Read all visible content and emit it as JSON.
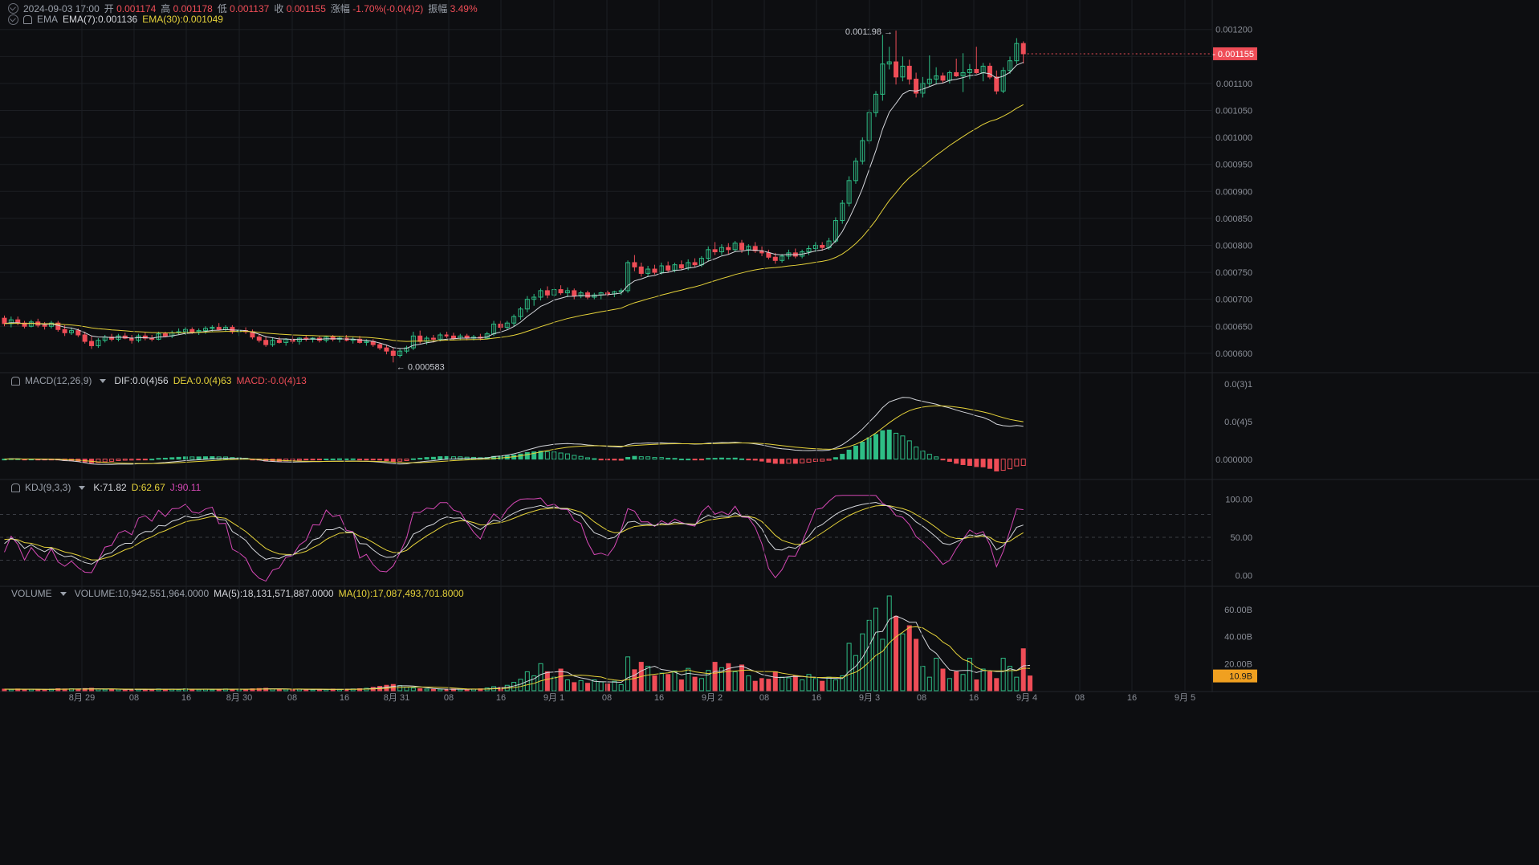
{
  "header": {
    "date": "2024-09-03 17:00",
    "open_label": "开",
    "open": "0.001174",
    "high_label": "高",
    "high": "0.001178",
    "low_label": "低",
    "low": "0.001137",
    "close_label": "收",
    "close": "0.001155",
    "change_label": "涨幅",
    "change": "-1.70%(-0.0(4)2)",
    "amp_label": "振幅",
    "amp": "3.49%"
  },
  "ema_header": {
    "name": "EMA",
    "ema7": "EMA(7):0.001136",
    "ema30": "EMA(30):0.001049"
  },
  "macd_header": {
    "name": "MACD(12,26,9)",
    "dif": "DIF:0.0(4)56",
    "dea": "DEA:0.0(4)63",
    "macd": "MACD:-0.0(4)13"
  },
  "kdj_header": {
    "name": "KDJ(9,3,3)",
    "k": "K:71.82",
    "d": "D:62.67",
    "j": "J:90.11"
  },
  "vol_header": {
    "name": "VOLUME",
    "vol": "VOLUME:10,942,551,964.0000",
    "ma5": "MA(5):18,131,571,887.0000",
    "ma10": "MA(10):17,087,493,701.8000"
  },
  "colors": {
    "up": "#2ebd85",
    "down": "#ef4d57",
    "ema7": "#d4d6db",
    "ema30": "#e5d23a",
    "j": "#d548b5",
    "bg": "#0d0e11",
    "grid": "#1c1e23"
  },
  "chart_data": {
    "type": "candlestick",
    "interval": "1h",
    "x_ticks": [
      "8月 29",
      "08",
      "16",
      "8月 30",
      "08",
      "16",
      "8月 31",
      "08",
      "16",
      "9月 1",
      "08",
      "16",
      "9月 2",
      "08",
      "16",
      "9月 3",
      "08",
      "16",
      "9月 4",
      "08",
      "16",
      "9月 5"
    ],
    "price_axis": [
      "0.001200",
      "0.001150",
      "0.001100",
      "0.001050",
      "0.001000",
      "0.000950",
      "0.000900",
      "0.000850",
      "0.000800",
      "0.000750",
      "0.000700",
      "0.000650",
      "0.000600"
    ],
    "price_ylim": [
      0.00057,
      0.00121
    ],
    "last_price": "0.001155",
    "max_annotation": "0.001198",
    "min_annotation": "0.000583",
    "ohlc": [
      [
        0.000665,
        0.00067,
        0.00065,
        0.000655
      ],
      [
        0.000655,
        0.000668,
        0.000648,
        0.000662
      ],
      [
        0.000662,
        0.000668,
        0.000652,
        0.000656
      ],
      [
        0.000656,
        0.00066,
        0.000646,
        0.00065
      ],
      [
        0.00065,
        0.000662,
        0.000648,
        0.000658
      ],
      [
        0.000658,
        0.000664,
        0.000648,
        0.000652
      ],
      [
        0.000652,
        0.000658,
        0.000644,
        0.00065
      ],
      [
        0.00065,
        0.00066,
        0.000646,
        0.000656
      ],
      [
        0.000656,
        0.00066,
        0.00064,
        0.000644
      ],
      [
        0.000644,
        0.000652,
        0.000632,
        0.000638
      ],
      [
        0.000638,
        0.000648,
        0.000634,
        0.000642
      ],
      [
        0.000642,
        0.000646,
        0.00063,
        0.000634
      ],
      [
        0.000634,
        0.00064,
        0.000618,
        0.000622
      ],
      [
        0.000622,
        0.000632,
        0.000608,
        0.000614
      ],
      [
        0.000614,
        0.000628,
        0.00061,
        0.000624
      ],
      [
        0.000624,
        0.000634,
        0.00062,
        0.00063
      ],
      [
        0.00063,
        0.000636,
        0.000622,
        0.000626
      ],
      [
        0.000626,
        0.000636,
        0.000622,
        0.000632
      ],
      [
        0.000632,
        0.000638,
        0.000626,
        0.000628
      ],
      [
        0.000628,
        0.000634,
        0.000618,
        0.000624
      ],
      [
        0.000624,
        0.000636,
        0.00062,
        0.000632
      ],
      [
        0.000632,
        0.000638,
        0.000624,
        0.000628
      ],
      [
        0.000628,
        0.000634,
        0.000622,
        0.000626
      ],
      [
        0.000626,
        0.00064,
        0.000624,
        0.000636
      ],
      [
        0.000636,
        0.00064,
        0.00063,
        0.000632
      ],
      [
        0.000632,
        0.000642,
        0.000628,
        0.000638
      ],
      [
        0.000638,
        0.000646,
        0.000634,
        0.00064
      ],
      [
        0.00064,
        0.000648,
        0.000634,
        0.000644
      ],
      [
        0.000644,
        0.000648,
        0.000636,
        0.00064
      ],
      [
        0.00064,
        0.000646,
        0.000634,
        0.000642
      ],
      [
        0.000642,
        0.00065,
        0.000636,
        0.000646
      ],
      [
        0.000646,
        0.000652,
        0.00064,
        0.000648
      ],
      [
        0.000648,
        0.000656,
        0.000642,
        0.000644
      ],
      [
        0.000644,
        0.000652,
        0.00064,
        0.000648
      ],
      [
        0.000648,
        0.000652,
        0.000636,
        0.00064
      ],
      [
        0.00064,
        0.000646,
        0.000632,
        0.000642
      ],
      [
        0.000642,
        0.000648,
        0.000636,
        0.00064
      ],
      [
        0.00064,
        0.000644,
        0.000626,
        0.00063
      ],
      [
        0.00063,
        0.000636,
        0.00062,
        0.000624
      ],
      [
        0.000624,
        0.000632,
        0.000612,
        0.000616
      ],
      [
        0.000616,
        0.000628,
        0.000612,
        0.000624
      ],
      [
        0.000624,
        0.00063,
        0.000618,
        0.00062
      ],
      [
        0.00062,
        0.000628,
        0.000614,
        0.000626
      ],
      [
        0.000626,
        0.000632,
        0.000618,
        0.000622
      ],
      [
        0.000622,
        0.00063,
        0.000616,
        0.000628
      ],
      [
        0.000628,
        0.000634,
        0.000622,
        0.000626
      ],
      [
        0.000626,
        0.00063,
        0.00062,
        0.000628
      ],
      [
        0.000628,
        0.000632,
        0.00062,
        0.000624
      ],
      [
        0.000624,
        0.000632,
        0.00062,
        0.00063
      ],
      [
        0.00063,
        0.000634,
        0.000622,
        0.000626
      ],
      [
        0.000626,
        0.000632,
        0.00062,
        0.000628
      ],
      [
        0.000628,
        0.000634,
        0.000622,
        0.000624
      ],
      [
        0.000624,
        0.00063,
        0.000618,
        0.000626
      ],
      [
        0.000626,
        0.000632,
        0.000618,
        0.00062
      ],
      [
        0.00062,
        0.000626,
        0.000614,
        0.000622
      ],
      [
        0.000622,
        0.000626,
        0.000612,
        0.000616
      ],
      [
        0.000616,
        0.00062,
        0.000606,
        0.00061
      ],
      [
        0.00061,
        0.000616,
        0.000598,
        0.000604
      ],
      [
        0.000604,
        0.00061,
        0.000583,
        0.000596
      ],
      [
        0.000596,
        0.000608,
        0.000592,
        0.000604
      ],
      [
        0.000604,
        0.000614,
        0.0006,
        0.00061
      ],
      [
        0.00061,
        0.00064,
        0.000606,
        0.000632
      ],
      [
        0.000632,
        0.000642,
        0.000618,
        0.000622
      ],
      [
        0.000622,
        0.000632,
        0.000616,
        0.000628
      ],
      [
        0.000628,
        0.000634,
        0.00062,
        0.000626
      ],
      [
        0.000626,
        0.000638,
        0.000622,
        0.000634
      ],
      [
        0.000634,
        0.00064,
        0.000628,
        0.000632
      ],
      [
        0.000632,
        0.000638,
        0.000624,
        0.000628
      ],
      [
        0.000628,
        0.000636,
        0.000624,
        0.000632
      ],
      [
        0.000632,
        0.000636,
        0.000624,
        0.000628
      ],
      [
        0.000628,
        0.000634,
        0.000624,
        0.00063
      ],
      [
        0.00063,
        0.000636,
        0.000624,
        0.000628
      ],
      [
        0.000628,
        0.00064,
        0.000626,
        0.000636
      ],
      [
        0.000636,
        0.00066,
        0.000632,
        0.000654
      ],
      [
        0.000654,
        0.00066,
        0.000642,
        0.000648
      ],
      [
        0.000648,
        0.00066,
        0.000644,
        0.000656
      ],
      [
        0.000656,
        0.000672,
        0.00065,
        0.000668
      ],
      [
        0.000668,
        0.000686,
        0.000662,
        0.000682
      ],
      [
        0.000682,
        0.000706,
        0.000676,
        0.0007
      ],
      [
        0.0007,
        0.00071,
        0.000688,
        0.000704
      ],
      [
        0.000704,
        0.00072,
        0.000698,
        0.000716
      ],
      [
        0.000716,
        0.000724,
        0.000702,
        0.000708
      ],
      [
        0.000708,
        0.000722,
        0.000704,
        0.000718
      ],
      [
        0.000718,
        0.000726,
        0.000708,
        0.000712
      ],
      [
        0.000712,
        0.000722,
        0.000704,
        0.000716
      ],
      [
        0.000716,
        0.00072,
        0.0007,
        0.000706
      ],
      [
        0.000706,
        0.000716,
        0.000702,
        0.000712
      ],
      [
        0.000712,
        0.000716,
        0.0007,
        0.000704
      ],
      [
        0.000704,
        0.000712,
        0.0007,
        0.000708
      ],
      [
        0.000708,
        0.000714,
        0.0007,
        0.000712
      ],
      [
        0.000712,
        0.000716,
        0.000706,
        0.00071
      ],
      [
        0.00071,
        0.000716,
        0.000704,
        0.000714
      ],
      [
        0.000714,
        0.00072,
        0.000708,
        0.000716
      ],
      [
        0.000716,
        0.000772,
        0.000712,
        0.000768
      ],
      [
        0.000768,
        0.000782,
        0.000752,
        0.00076
      ],
      [
        0.00076,
        0.000768,
        0.000742,
        0.000748
      ],
      [
        0.000748,
        0.000762,
        0.000742,
        0.000756
      ],
      [
        0.000756,
        0.000764,
        0.000746,
        0.00075
      ],
      [
        0.00075,
        0.000768,
        0.000746,
        0.000762
      ],
      [
        0.000762,
        0.00077,
        0.00075,
        0.000754
      ],
      [
        0.000754,
        0.000768,
        0.00075,
        0.000764
      ],
      [
        0.000764,
        0.000772,
        0.000754,
        0.000758
      ],
      [
        0.000758,
        0.000774,
        0.000754,
        0.000768
      ],
      [
        0.000768,
        0.000776,
        0.00076,
        0.000764
      ],
      [
        0.000764,
        0.00078,
        0.00076,
        0.000776
      ],
      [
        0.000776,
        0.000798,
        0.00077,
        0.000792
      ],
      [
        0.000792,
        0.000806,
        0.000782,
        0.000788
      ],
      [
        0.000788,
        0.000802,
        0.000782,
        0.000796
      ],
      [
        0.000796,
        0.000804,
        0.000784,
        0.000792
      ],
      [
        0.000792,
        0.000808,
        0.000788,
        0.000804
      ],
      [
        0.000804,
        0.00081,
        0.000786,
        0.000792
      ],
      [
        0.000792,
        0.000802,
        0.000782,
        0.000798
      ],
      [
        0.000798,
        0.000806,
        0.000786,
        0.00079
      ],
      [
        0.00079,
        0.000798,
        0.00078,
        0.000786
      ],
      [
        0.000786,
        0.000792,
        0.000774,
        0.000778
      ],
      [
        0.000778,
        0.000786,
        0.000766,
        0.000772
      ],
      [
        0.000772,
        0.000784,
        0.000768,
        0.00078
      ],
      [
        0.00078,
        0.000792,
        0.000774,
        0.000786
      ],
      [
        0.000786,
        0.000794,
        0.000776,
        0.00078
      ],
      [
        0.00078,
        0.000792,
        0.000776,
        0.000788
      ],
      [
        0.000788,
        0.0008,
        0.000782,
        0.000794
      ],
      [
        0.000794,
        0.000806,
        0.000788,
        0.0008
      ],
      [
        0.0008,
        0.000806,
        0.00079,
        0.000796
      ],
      [
        0.000796,
        0.000814,
        0.000792,
        0.000808
      ],
      [
        0.000808,
        0.000852,
        0.000804,
        0.000846
      ],
      [
        0.000846,
        0.000884,
        0.00084,
        0.000878
      ],
      [
        0.000878,
        0.000928,
        0.000872,
        0.00092
      ],
      [
        0.00092,
        0.000962,
        0.000914,
        0.000956
      ],
      [
        0.000956,
        0.001,
        0.00095,
        0.000994
      ],
      [
        0.000994,
        0.001052,
        0.000988,
        0.001046
      ],
      [
        0.001046,
        0.001086,
        0.001038,
        0.00108
      ],
      [
        0.00108,
        0.00119,
        0.001068,
        0.001136
      ],
      [
        0.001136,
        0.001168,
        0.001126,
        0.00114
      ],
      [
        0.00114,
        0.001198,
        0.001098,
        0.001112
      ],
      [
        0.001112,
        0.00115,
        0.001104,
        0.001132
      ],
      [
        0.001132,
        0.001144,
        0.001098,
        0.001108
      ],
      [
        0.001108,
        0.00112,
        0.001074,
        0.001082
      ],
      [
        0.001082,
        0.001112,
        0.001074,
        0.0011
      ],
      [
        0.0011,
        0.001152,
        0.001094,
        0.001108
      ],
      [
        0.001108,
        0.00113,
        0.001098,
        0.001114
      ],
      [
        0.001114,
        0.00112,
        0.0011,
        0.001106
      ],
      [
        0.001106,
        0.001124,
        0.0011,
        0.00112
      ],
      [
        0.00112,
        0.001146,
        0.001112,
        0.001114
      ],
      [
        0.001114,
        0.001156,
        0.001084,
        0.00112
      ],
      [
        0.00112,
        0.001136,
        0.001108,
        0.001126
      ],
      [
        0.001126,
        0.001168,
        0.001118,
        0.00112
      ],
      [
        0.00112,
        0.001138,
        0.001104,
        0.001132
      ],
      [
        0.001132,
        0.001138,
        0.001108,
        0.001112
      ],
      [
        0.001112,
        0.001124,
        0.00108,
        0.001086
      ],
      [
        0.001086,
        0.00113,
        0.001082,
        0.001124
      ],
      [
        0.001124,
        0.00115,
        0.001118,
        0.001142
      ],
      [
        0.001142,
        0.001184,
        0.001136,
        0.001174
      ],
      [
        0.001174,
        0.001178,
        0.001137,
        0.001155
      ]
    ],
    "ema7_last": 0.001136,
    "ema30_last": 0.001049,
    "macd_axis": [
      "0.0(3)1",
      "0.0(4)5",
      "0.000000"
    ],
    "macd_ylim": [
      -2.5e-05,
      0.000115
    ],
    "kdj_axis": [
      "100.00",
      "50.00",
      "0.00"
    ],
    "kdj_ylim": [
      -10,
      110
    ],
    "volume_axis": [
      "60.00B",
      "40.00B",
      "20.00B"
    ],
    "volume_ylim": [
      0,
      70
    ],
    "volume_last_label": "10.9B",
    "volume_billions": [
      1.2,
      1.0,
      1.3,
      0.9,
      1.1,
      1.0,
      0.8,
      1.2,
      1.5,
      1.3,
      1.4,
      1.1,
      1.6,
      1.8,
      1.2,
      1.0,
      0.9,
      1.1,
      0.8,
      1.0,
      1.2,
      0.9,
      1.1,
      1.3,
      1.0,
      1.2,
      0.9,
      1.4,
      1.1,
      1.0,
      1.2,
      0.8,
      1.1,
      1.3,
      1.0,
      1.2,
      0.9,
      1.4,
      1.6,
      1.8,
      1.2,
      1.0,
      1.1,
      0.9,
      1.2,
      1.0,
      0.8,
      1.1,
      0.9,
      1.2,
      1.0,
      1.1,
      1.3,
      1.5,
      1.8,
      2.5,
      3.2,
      4.0,
      4.6,
      3.8,
      2.6,
      2.0,
      1.5,
      1.2,
      1.0,
      1.1,
      0.9,
      1.3,
      1.1,
      1.0,
      1.2,
      1.4,
      2.0,
      3.0,
      2.4,
      4.0,
      6.2,
      8.5,
      14.0,
      11.0,
      20.0,
      14.0,
      10.0,
      16.0,
      8.0,
      6.0,
      7.5,
      5.5,
      8.0,
      6.5,
      5.0,
      7.0,
      4.5,
      25.0,
      15.5,
      21.0,
      18.0,
      11.0,
      13.0,
      12.0,
      14.5,
      8.0,
      16.5,
      10.0,
      9.0,
      15.0,
      21.0,
      17.0,
      20.0,
      14.0,
      19.0,
      11.0,
      7.0,
      9.0,
      8.5,
      14.0,
      10.0,
      9.5,
      11.0,
      8.0,
      12.0,
      9.0,
      7.0,
      10.0,
      8.0,
      11.0,
      35.0,
      26.0,
      42.0,
      52.0,
      61.0,
      38.0,
      70.0,
      55.0,
      42.0,
      48.0,
      38.0,
      18.0,
      10.0,
      24.0,
      16.0,
      9.0,
      14.0,
      12.0,
      24.0,
      8.0,
      16.0,
      14.0,
      9.0,
      24.0,
      18.0,
      10.0,
      31.0,
      10.9
    ]
  }
}
